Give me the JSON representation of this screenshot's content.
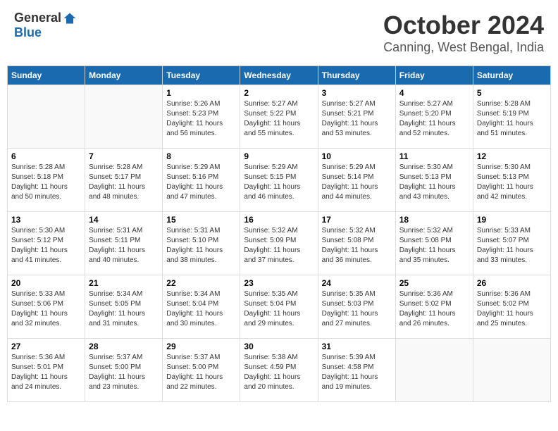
{
  "logo": {
    "general": "General",
    "blue": "Blue"
  },
  "title": {
    "month": "October 2024",
    "location": "Canning, West Bengal, India"
  },
  "weekdays": [
    "Sunday",
    "Monday",
    "Tuesday",
    "Wednesday",
    "Thursday",
    "Friday",
    "Saturday"
  ],
  "weeks": [
    [
      {
        "num": "",
        "sunrise": "",
        "sunset": "",
        "daylight": ""
      },
      {
        "num": "",
        "sunrise": "",
        "sunset": "",
        "daylight": ""
      },
      {
        "num": "1",
        "sunrise": "Sunrise: 5:26 AM",
        "sunset": "Sunset: 5:23 PM",
        "daylight": "Daylight: 11 hours and 56 minutes."
      },
      {
        "num": "2",
        "sunrise": "Sunrise: 5:27 AM",
        "sunset": "Sunset: 5:22 PM",
        "daylight": "Daylight: 11 hours and 55 minutes."
      },
      {
        "num": "3",
        "sunrise": "Sunrise: 5:27 AM",
        "sunset": "Sunset: 5:21 PM",
        "daylight": "Daylight: 11 hours and 53 minutes."
      },
      {
        "num": "4",
        "sunrise": "Sunrise: 5:27 AM",
        "sunset": "Sunset: 5:20 PM",
        "daylight": "Daylight: 11 hours and 52 minutes."
      },
      {
        "num": "5",
        "sunrise": "Sunrise: 5:28 AM",
        "sunset": "Sunset: 5:19 PM",
        "daylight": "Daylight: 11 hours and 51 minutes."
      }
    ],
    [
      {
        "num": "6",
        "sunrise": "Sunrise: 5:28 AM",
        "sunset": "Sunset: 5:18 PM",
        "daylight": "Daylight: 11 hours and 50 minutes."
      },
      {
        "num": "7",
        "sunrise": "Sunrise: 5:28 AM",
        "sunset": "Sunset: 5:17 PM",
        "daylight": "Daylight: 11 hours and 48 minutes."
      },
      {
        "num": "8",
        "sunrise": "Sunrise: 5:29 AM",
        "sunset": "Sunset: 5:16 PM",
        "daylight": "Daylight: 11 hours and 47 minutes."
      },
      {
        "num": "9",
        "sunrise": "Sunrise: 5:29 AM",
        "sunset": "Sunset: 5:15 PM",
        "daylight": "Daylight: 11 hours and 46 minutes."
      },
      {
        "num": "10",
        "sunrise": "Sunrise: 5:29 AM",
        "sunset": "Sunset: 5:14 PM",
        "daylight": "Daylight: 11 hours and 44 minutes."
      },
      {
        "num": "11",
        "sunrise": "Sunrise: 5:30 AM",
        "sunset": "Sunset: 5:13 PM",
        "daylight": "Daylight: 11 hours and 43 minutes."
      },
      {
        "num": "12",
        "sunrise": "Sunrise: 5:30 AM",
        "sunset": "Sunset: 5:13 PM",
        "daylight": "Daylight: 11 hours and 42 minutes."
      }
    ],
    [
      {
        "num": "13",
        "sunrise": "Sunrise: 5:30 AM",
        "sunset": "Sunset: 5:12 PM",
        "daylight": "Daylight: 11 hours and 41 minutes."
      },
      {
        "num": "14",
        "sunrise": "Sunrise: 5:31 AM",
        "sunset": "Sunset: 5:11 PM",
        "daylight": "Daylight: 11 hours and 40 minutes."
      },
      {
        "num": "15",
        "sunrise": "Sunrise: 5:31 AM",
        "sunset": "Sunset: 5:10 PM",
        "daylight": "Daylight: 11 hours and 38 minutes."
      },
      {
        "num": "16",
        "sunrise": "Sunrise: 5:32 AM",
        "sunset": "Sunset: 5:09 PM",
        "daylight": "Daylight: 11 hours and 37 minutes."
      },
      {
        "num": "17",
        "sunrise": "Sunrise: 5:32 AM",
        "sunset": "Sunset: 5:08 PM",
        "daylight": "Daylight: 11 hours and 36 minutes."
      },
      {
        "num": "18",
        "sunrise": "Sunrise: 5:32 AM",
        "sunset": "Sunset: 5:08 PM",
        "daylight": "Daylight: 11 hours and 35 minutes."
      },
      {
        "num": "19",
        "sunrise": "Sunrise: 5:33 AM",
        "sunset": "Sunset: 5:07 PM",
        "daylight": "Daylight: 11 hours and 33 minutes."
      }
    ],
    [
      {
        "num": "20",
        "sunrise": "Sunrise: 5:33 AM",
        "sunset": "Sunset: 5:06 PM",
        "daylight": "Daylight: 11 hours and 32 minutes."
      },
      {
        "num": "21",
        "sunrise": "Sunrise: 5:34 AM",
        "sunset": "Sunset: 5:05 PM",
        "daylight": "Daylight: 11 hours and 31 minutes."
      },
      {
        "num": "22",
        "sunrise": "Sunrise: 5:34 AM",
        "sunset": "Sunset: 5:04 PM",
        "daylight": "Daylight: 11 hours and 30 minutes."
      },
      {
        "num": "23",
        "sunrise": "Sunrise: 5:35 AM",
        "sunset": "Sunset: 5:04 PM",
        "daylight": "Daylight: 11 hours and 29 minutes."
      },
      {
        "num": "24",
        "sunrise": "Sunrise: 5:35 AM",
        "sunset": "Sunset: 5:03 PM",
        "daylight": "Daylight: 11 hours and 27 minutes."
      },
      {
        "num": "25",
        "sunrise": "Sunrise: 5:36 AM",
        "sunset": "Sunset: 5:02 PM",
        "daylight": "Daylight: 11 hours and 26 minutes."
      },
      {
        "num": "26",
        "sunrise": "Sunrise: 5:36 AM",
        "sunset": "Sunset: 5:02 PM",
        "daylight": "Daylight: 11 hours and 25 minutes."
      }
    ],
    [
      {
        "num": "27",
        "sunrise": "Sunrise: 5:36 AM",
        "sunset": "Sunset: 5:01 PM",
        "daylight": "Daylight: 11 hours and 24 minutes."
      },
      {
        "num": "28",
        "sunrise": "Sunrise: 5:37 AM",
        "sunset": "Sunset: 5:00 PM",
        "daylight": "Daylight: 11 hours and 23 minutes."
      },
      {
        "num": "29",
        "sunrise": "Sunrise: 5:37 AM",
        "sunset": "Sunset: 5:00 PM",
        "daylight": "Daylight: 11 hours and 22 minutes."
      },
      {
        "num": "30",
        "sunrise": "Sunrise: 5:38 AM",
        "sunset": "Sunset: 4:59 PM",
        "daylight": "Daylight: 11 hours and 20 minutes."
      },
      {
        "num": "31",
        "sunrise": "Sunrise: 5:39 AM",
        "sunset": "Sunset: 4:58 PM",
        "daylight": "Daylight: 11 hours and 19 minutes."
      },
      {
        "num": "",
        "sunrise": "",
        "sunset": "",
        "daylight": ""
      },
      {
        "num": "",
        "sunrise": "",
        "sunset": "",
        "daylight": ""
      }
    ]
  ]
}
